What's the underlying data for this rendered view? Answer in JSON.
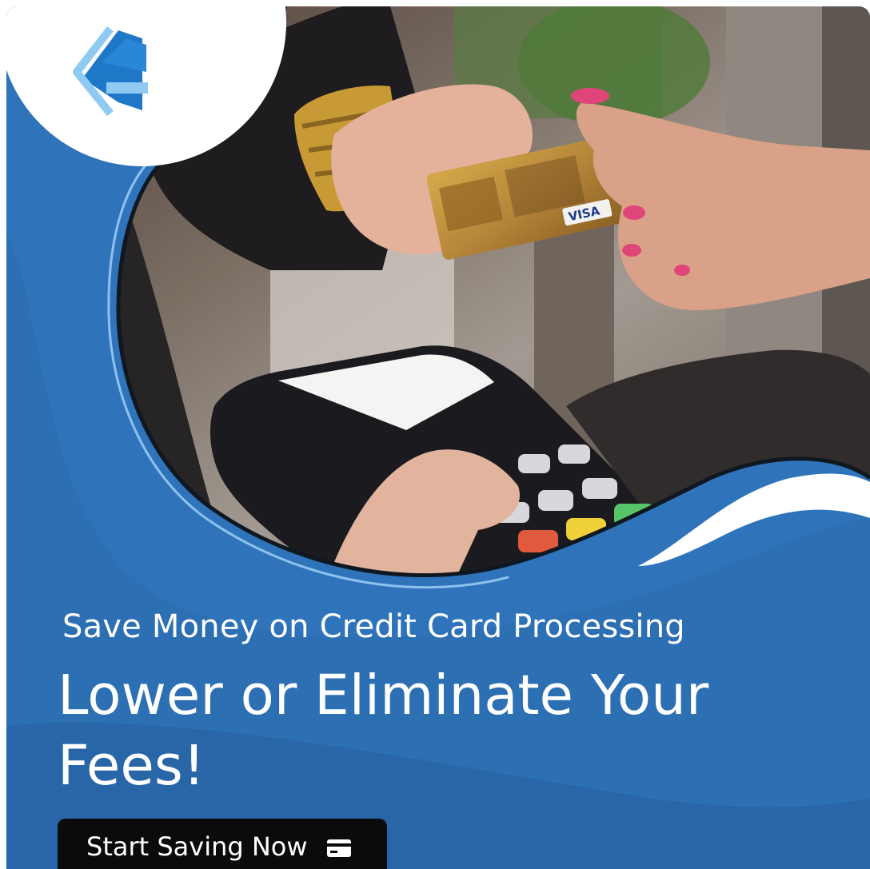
{
  "ad": {
    "tagline": "Save Money on Credit Card Processing",
    "headline": "Lower or Eliminate Your Fees!",
    "cta_label": "Start Saving Now",
    "cta_icon": "credit-card-icon",
    "logo": "brand-chevron-logo",
    "photo": "card-payment-terminal-photo",
    "card_text": "VISA"
  },
  "colors": {
    "brand_blue": "#2f74bb",
    "dark_blue": "#245f9e",
    "light_blue": "#6fb7ee",
    "cta_bg": "#0b0b0d",
    "text": "#ffffff"
  }
}
